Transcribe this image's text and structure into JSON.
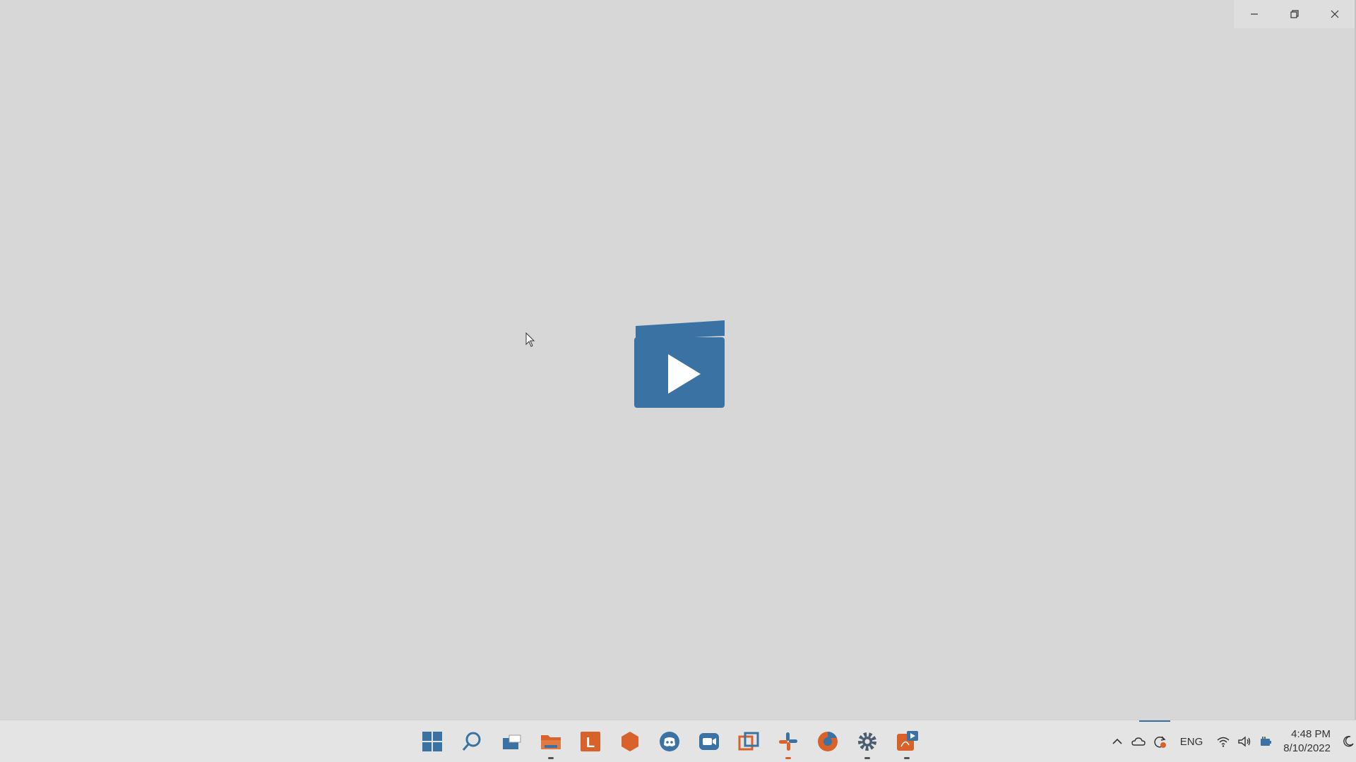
{
  "window": {
    "caption": {
      "minimize": "minimize-icon",
      "restore": "restore-icon",
      "close": "close-icon"
    }
  },
  "splash": {
    "icon": "video-player-icon",
    "color": "#3a72a3"
  },
  "taskbar": {
    "apps": [
      {
        "name": "start",
        "icon": "windows-start-icon",
        "running": false
      },
      {
        "name": "search",
        "icon": "search-icon",
        "running": false
      },
      {
        "name": "task-view",
        "icon": "task-view-icon",
        "running": false
      },
      {
        "name": "file-explorer",
        "icon": "folder-icon",
        "running": true
      },
      {
        "name": "app-l",
        "icon": "l-app-icon",
        "label": "L",
        "running": false
      },
      {
        "name": "app-hexagon",
        "icon": "hexagon-app-icon",
        "running": false
      },
      {
        "name": "discord",
        "icon": "discord-icon",
        "running": false
      },
      {
        "name": "zoom",
        "icon": "video-camera-icon",
        "running": false
      },
      {
        "name": "screen-capture",
        "icon": "screen-capture-icon",
        "running": false
      },
      {
        "name": "slack",
        "icon": "slack-icon",
        "running": true
      },
      {
        "name": "browser",
        "icon": "browser-icon",
        "running": false
      },
      {
        "name": "settings",
        "icon": "gear-icon",
        "running": true
      },
      {
        "name": "pdf-reader",
        "icon": "pdf-icon",
        "running": true
      }
    ],
    "tray": {
      "chevron": "chevron-up-icon",
      "cloud": "onedrive-cloud-icon",
      "sync": "sync-icon",
      "language": "ENG",
      "wifi": "wifi-icon",
      "volume": "volume-icon",
      "battery": "battery-icon",
      "time": "4:48 PM",
      "date": "8/10/2022",
      "focus": "moon-icon"
    }
  },
  "colors": {
    "accent": "#3a72a3",
    "orange": "#d9622b",
    "background": "#d7d7d7"
  }
}
